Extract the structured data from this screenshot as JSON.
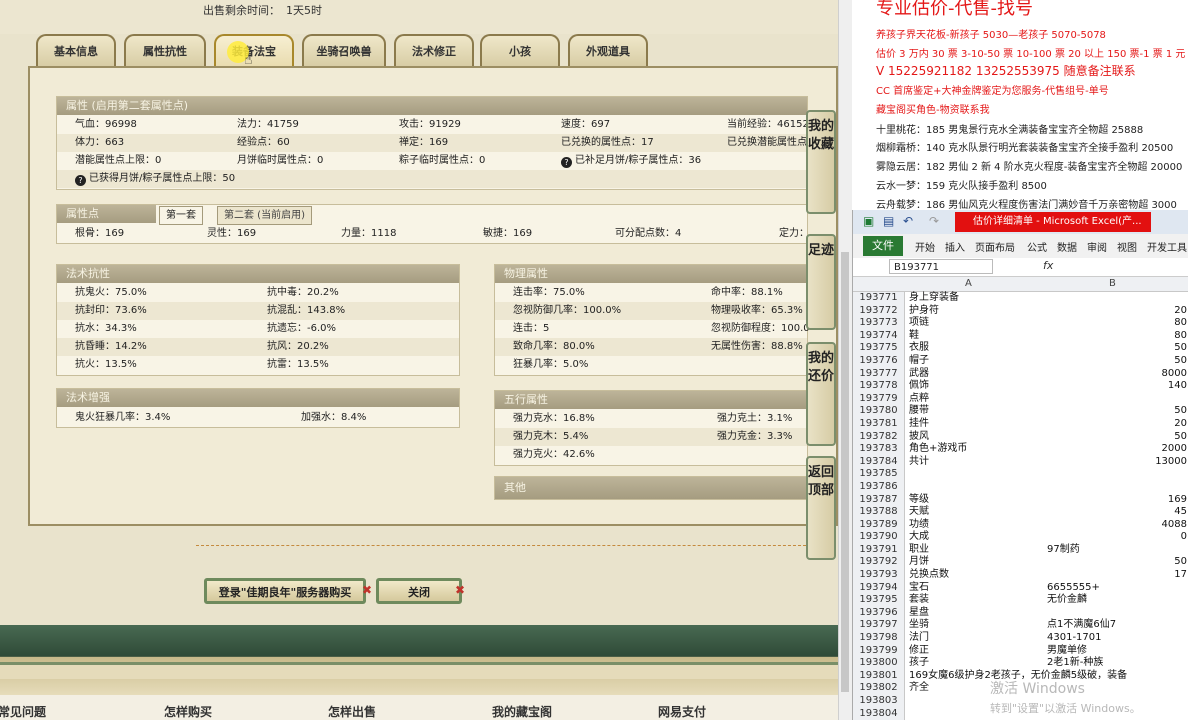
{
  "header": {
    "sell_time_label": "出售剩余时间：",
    "sell_time_value": "1天5时"
  },
  "tabs": [
    "基本信息",
    "属性抗性",
    "装备法宝",
    "坐骑召唤兽",
    "法术修正",
    "小孩",
    "外观道具"
  ],
  "attributes": {
    "title": "属性 (启用第二套属性点)",
    "rows": [
      [
        "气血：96998",
        "法力：41759",
        "攻击：91929",
        "速度：697",
        "当前经验：46152"
      ],
      [
        "体力：663",
        "经验点：60",
        "禅定：169",
        "已兑换的属性点：17",
        "已兑换潜能属性点"
      ],
      [
        "潜能属性点上限：0",
        "月饼临时属性点：0",
        "粽子临时属性点：0",
        "已补足月饼/粽子属性点：36",
        ""
      ],
      [
        "已获得月饼/粽子属性点上限：50",
        "",
        "",
        "",
        ""
      ]
    ]
  },
  "points": {
    "title": "属性点",
    "tab1": "第一套",
    "tab2": "第二套 (当前启用)",
    "row": [
      "根骨：169",
      "灵性：169",
      "力量：1118",
      "敏捷：169",
      "可分配点数：4",
      "定力："
    ]
  },
  "resist": {
    "title": "法术抗性",
    "rows": [
      [
        "抗鬼火：75.0%",
        "抗中毒：20.2%"
      ],
      [
        "抗封印：73.6%",
        "抗混乱：143.8%"
      ],
      [
        "抗水：34.3%",
        "抗遗忘：-6.0%"
      ],
      [
        "抗昏睡：14.2%",
        "抗风：20.2%"
      ],
      [
        "抗火：13.5%",
        "抗雷：13.5%"
      ]
    ]
  },
  "physical": {
    "title": "物理属性",
    "rows": [
      [
        "连击率：75.0%",
        "命中率：88.1%"
      ],
      [
        "忽视防御几率：100.0%",
        "物理吸收率：65.3%"
      ],
      [
        "连击：5",
        "忽视防御程度：100.0"
      ],
      [
        "致命几率：80.0%",
        "无属性伤害：88.8%"
      ],
      [
        "狂暴几率：5.0%",
        ""
      ]
    ]
  },
  "enhance": {
    "title": "法术增强",
    "rows": [
      [
        "鬼火狂暴几率：3.4%",
        "加强水：8.4%"
      ]
    ]
  },
  "wuxing": {
    "title": "五行属性",
    "rows": [
      [
        "强力克水：16.8%",
        "强力克土：3.1%"
      ],
      [
        "强力克木：5.4%",
        "强力克金：3.3%"
      ],
      [
        "强力克火：42.6%",
        ""
      ]
    ]
  },
  "other": {
    "title": "其他"
  },
  "side_buttons": [
    "我的收藏",
    "足迹",
    "我的还价",
    "返回顶部"
  ],
  "buttons": {
    "login": "登录\"佳期良年\"服务器购买",
    "close": "关闭"
  },
  "footer": [
    "常见问题",
    "怎样购买",
    "怎样出售",
    "我的藏宝阁",
    "网易支付"
  ],
  "ads": {
    "title": "专业估价-代售-找号",
    "lines": [
      "养孩子界天花板-新孩子 5030—老孩子 5070-5078",
      "估价 3 万内 30 票 3-10-50 票 10-100 票 20 以上 150 票-1 票 1 元",
      "V 15225921182     13252553975     随意备注联系",
      "CC 首席鉴定+大神金牌鉴定为您服务-代售组号-单号",
      "藏宝阁买角色-物资联系我",
      "十里桃花：185 男鬼景行克水全满装备宝宝齐全物超 25888",
      "烟柳霜桥：140 克水队景行明光套装装备宝宝齐全接手盈利 20500",
      "雾隐云居：182 男仙 2 新 4 阶水克火程度-装备宝宝齐全物超 20000",
      "云水一梦：159 克火队接手盈利 8500",
      "云舟载梦：186 男仙风克火程度伤害法门满妙音千万亲密物超 3000"
    ]
  },
  "excel": {
    "doc_title": "估价详细清单 - Microsoft Excel(产...",
    "ribbon_file": "文件",
    "ribbon_tabs": [
      "开始",
      "插入",
      "页面布局",
      "公式",
      "数据",
      "审阅",
      "视图",
      "开发工具"
    ],
    "name_box": "B193771",
    "col_a": "A",
    "col_b": "B",
    "rows": [
      {
        "n": "193771",
        "a": "身上穿装备",
        "b": ""
      },
      {
        "n": "193772",
        "a": "护身符",
        "b": "20"
      },
      {
        "n": "193773",
        "a": "项链",
        "b": "80"
      },
      {
        "n": "193774",
        "a": "鞋",
        "b": "80"
      },
      {
        "n": "193775",
        "a": "衣服",
        "b": "50"
      },
      {
        "n": "193776",
        "a": "帽子",
        "b": "50"
      },
      {
        "n": "193777",
        "a": "武器",
        "b": "8000"
      },
      {
        "n": "193778",
        "a": "佩饰",
        "b": "140"
      },
      {
        "n": "193779",
        "a": "点粹",
        "b": ""
      },
      {
        "n": "193780",
        "a": "腰带",
        "b": "50"
      },
      {
        "n": "193781",
        "a": "挂件",
        "b": "20"
      },
      {
        "n": "193782",
        "a": "披风",
        "b": "50"
      },
      {
        "n": "193783",
        "a": "角色+游戏币",
        "b": "2000"
      },
      {
        "n": "193784",
        "a": "共计",
        "b": "13000"
      },
      {
        "n": "193785",
        "a": "",
        "b": ""
      },
      {
        "n": "193786",
        "a": "",
        "b": ""
      },
      {
        "n": "193787",
        "a": "等级",
        "b": "169"
      },
      {
        "n": "193788",
        "a": "天赋",
        "b": "45"
      },
      {
        "n": "193789",
        "a": "功绩",
        "b": "4088"
      },
      {
        "n": "193790",
        "a": "大成",
        "b": "0"
      },
      {
        "n": "193791",
        "a": "职业",
        "b": "97制药",
        "text": true
      },
      {
        "n": "193792",
        "a": "月饼",
        "b": "50"
      },
      {
        "n": "193793",
        "a": "兑换点数",
        "b": "17"
      },
      {
        "n": "193794",
        "a": "宝石",
        "b": "6655555+",
        "text": true
      },
      {
        "n": "193795",
        "a": "套装",
        "b": "无价金麟",
        "text": true
      },
      {
        "n": "193796",
        "a": "星盘",
        "b": ""
      },
      {
        "n": "193797",
        "a": "坐骑",
        "b": "点1不满魔6仙7",
        "text": true
      },
      {
        "n": "193798",
        "a": "法门",
        "b": "4301-1701",
        "text": true
      },
      {
        "n": "193799",
        "a": "修正",
        "b": "男魔单修",
        "text": true
      },
      {
        "n": "193800",
        "a": "孩子",
        "b": "2老1新-种族",
        "text": true
      },
      {
        "n": "193801",
        "a": "169女魔6级护身2老孩子，无价金麟5级破，装备",
        "b": ""
      },
      {
        "n": "193802",
        "a": "齐全",
        "b": ""
      },
      {
        "n": "193803",
        "a": "",
        "b": ""
      },
      {
        "n": "193804",
        "a": "",
        "b": ""
      }
    ]
  },
  "watermark": {
    "line1": "激活 Windows",
    "line2": "转到\"设置\"以激活 Windows。"
  }
}
